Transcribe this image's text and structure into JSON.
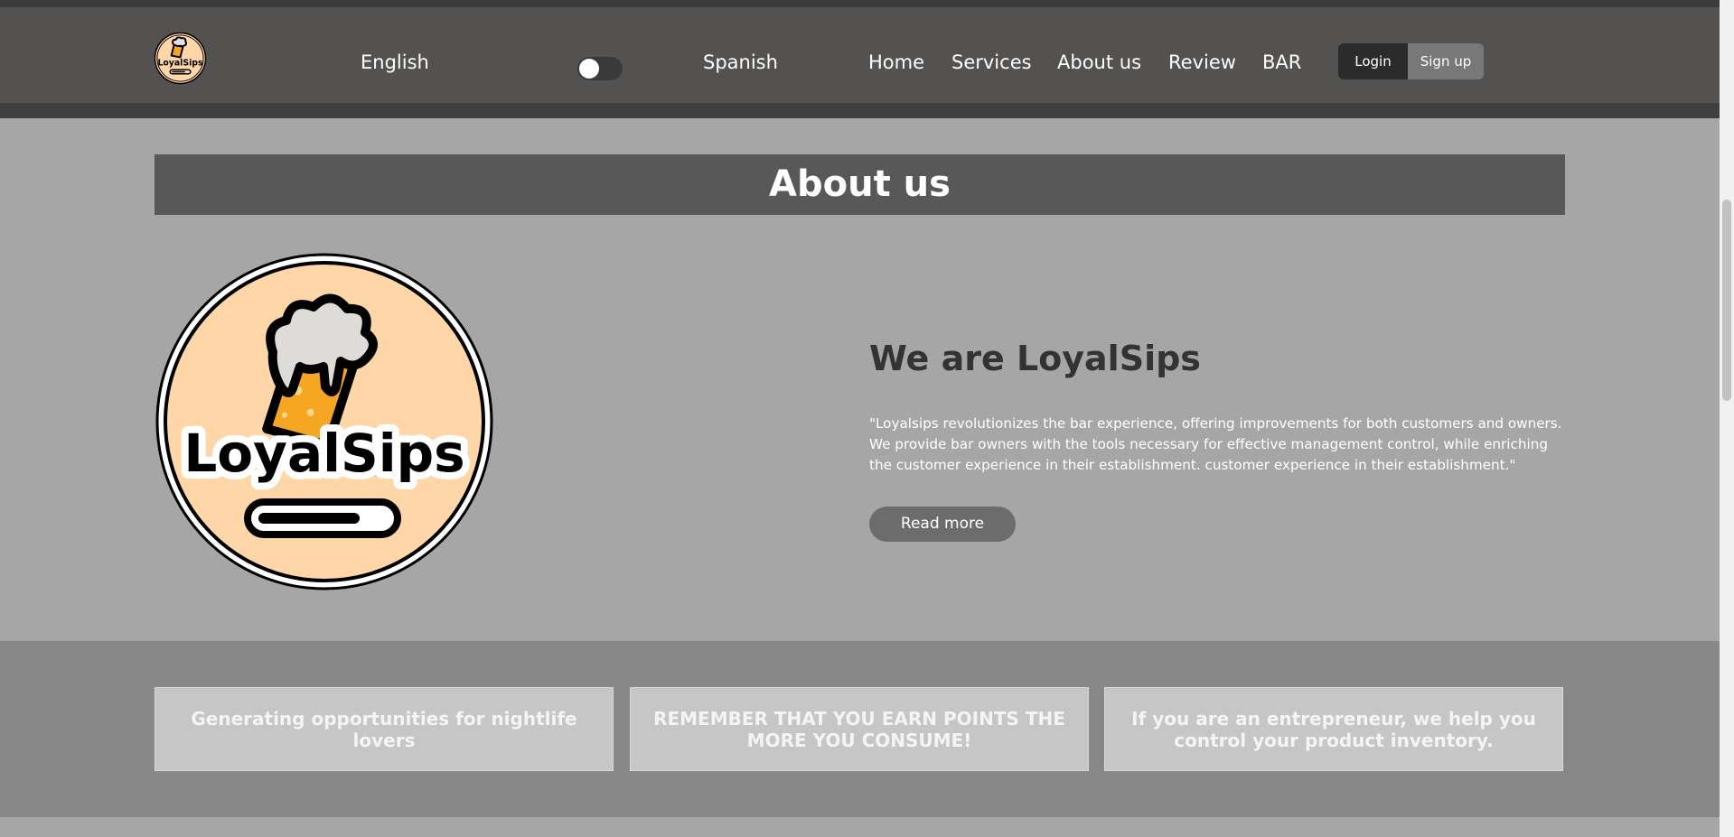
{
  "header": {
    "logo_text": "LoyalSips",
    "language_left": "English",
    "language_right": "Spanish",
    "nav": [
      "Home",
      "Services",
      "About us",
      "Review",
      "BAR"
    ],
    "login_label": "Login",
    "signup_label": "Sign up"
  },
  "about": {
    "banner_title": "About us",
    "logo_text": "LoyalSips",
    "heading": "We are LoyalSips",
    "text": "\"Loyalsips revolutionizes the bar experience, offering improvements for both customers and owners. We provide bar owners with the tools necessary for effective management control, while enriching the customer experience in their establishment. customer experience in their establishment.\"",
    "button_label": "Read more"
  },
  "features": [
    {
      "text": "Generating opportunities for nightlife lovers"
    },
    {
      "text": "REMEMBER THAT YOU EARN POINTS THE MORE YOU CONSUME!"
    },
    {
      "text": "If you are an entrepreneur, we help you control your product inventory."
    }
  ],
  "colors": {
    "navbar": "#545250",
    "page_bg": "#a6a6a6",
    "banner": "#585858",
    "features_bg": "#888888",
    "logo_fill": "#fed6a8",
    "beer": "#f5a623"
  },
  "icons": {
    "logo": "beer-mug-logo",
    "toggle": "language-toggle"
  }
}
